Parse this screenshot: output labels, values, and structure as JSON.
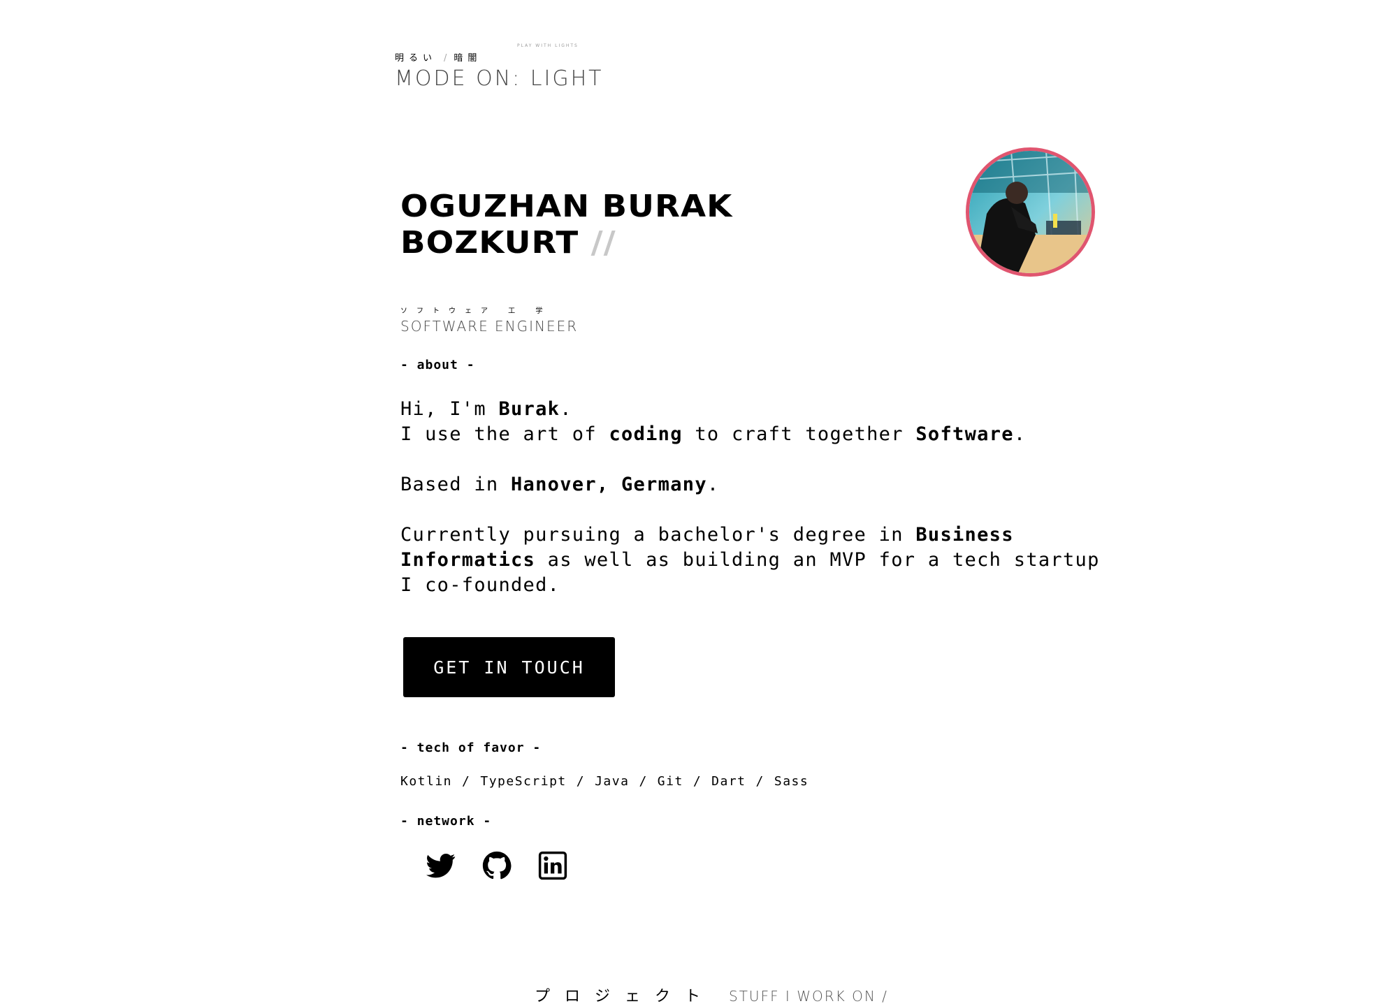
{
  "mode_switcher": {
    "light_jp": "明るい",
    "separator": "/",
    "dark_jp": "暗闇",
    "hint": "PLAY WITH LIGHTS",
    "label": "MODE ON: LIGHT"
  },
  "profile": {
    "name_line1": "OGUZHAN BURAK",
    "name_line2": "BOZKURT",
    "name_decoration": "//",
    "role_jp": "ソフトウェア 工 学",
    "role": "SOFTWARE ENGINEER",
    "avatar_border_color": "#e0556f"
  },
  "about": {
    "label": "- about -",
    "greeting_pre": "Hi, I'm ",
    "greeting_name": "Burak",
    "greeting_post": ".",
    "line2_pre": "I use the art of ",
    "line2_b1": "coding",
    "line2_mid": " to craft together ",
    "line2_b2": "Software",
    "line2_post": ".",
    "based_pre": "Based in ",
    "based_place": "Hanover, Germany",
    "based_post": ".",
    "study_pre": "Currently pursuing a bachelor's degree in ",
    "study_field": "Business Informatics",
    "study_post": " as well as building an MVP for a tech startup I co-founded."
  },
  "cta": {
    "label": "GET IN TOUCH"
  },
  "tech": {
    "label": "- tech of favor -",
    "items": [
      "Kotlin",
      "TypeScript",
      "Java",
      "Git",
      "Dart",
      "Sass"
    ],
    "separator": "/"
  },
  "network": {
    "label": "- network -",
    "icons": [
      "twitter-icon",
      "github-icon",
      "linkedin-icon"
    ]
  },
  "projects": {
    "label_jp": "プロジェクト",
    "label": "STUFF I WORK ON /"
  }
}
